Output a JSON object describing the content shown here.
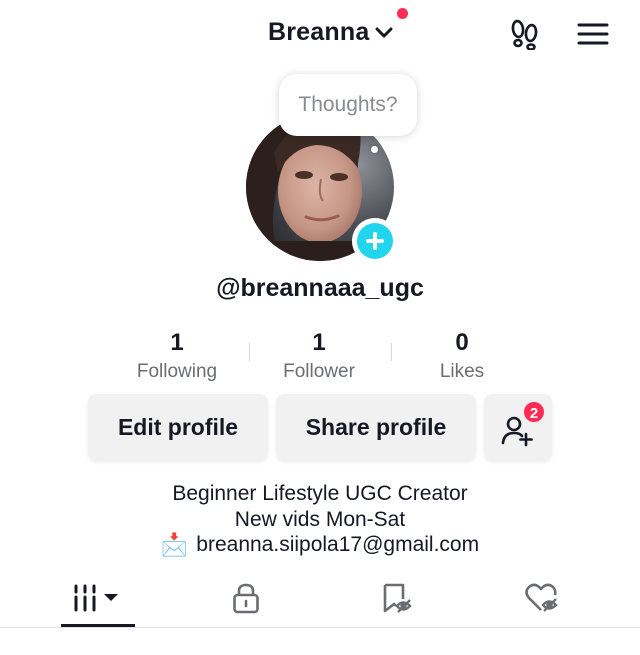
{
  "header": {
    "username_title": "Breanna",
    "icons": [
      "chevron-down-icon",
      "notification-dot",
      "footprints-icon",
      "menu-icon"
    ],
    "accent_color": "#fe2c55"
  },
  "profile": {
    "thoughts_prompt": "Thoughts?",
    "handle": "@breannaaa_ugc",
    "add_color": "#20d5ec"
  },
  "stats": [
    {
      "value": "1",
      "label": "Following"
    },
    {
      "value": "1",
      "label": "Follower"
    },
    {
      "value": "0",
      "label": "Likes"
    }
  ],
  "actions": {
    "edit_label": "Edit profile",
    "share_label": "Share profile",
    "friends_badge": "2"
  },
  "bio": {
    "line1": "Beginner Lifestyle UGC Creator",
    "line2": "New vids Mon-Sat",
    "email_emoji": "📩",
    "email": "breanna.siipola17@gmail.com"
  },
  "tabs": [
    "videos-grid-icon",
    "private-lock-icon",
    "saved-bookmark-icon",
    "liked-heart-icon"
  ]
}
